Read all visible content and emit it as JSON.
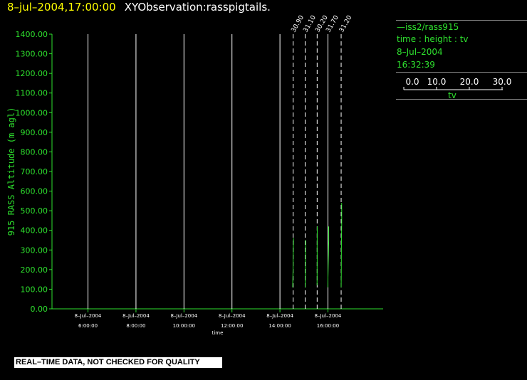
{
  "title": {
    "datetime": "8–jul–2004,17:00:00",
    "observation": "XYObservation:rasspigtails."
  },
  "legend": {
    "station": "—iss2/rass915",
    "variables": "time : height : tv",
    "date": "8–Jul–2004",
    "time": "16:32:39",
    "scale_ticks": [
      "0.0",
      "10.0",
      "20.0",
      "30.0"
    ],
    "scale_label": "tv"
  },
  "warning": "REAL–TIME DATA, NOT CHECKED FOR QUALITY",
  "colors": {
    "axis": "#2ee02e",
    "trace": "#2ee02e",
    "gridline": "#ffffff",
    "title_time": "#ffff00",
    "background": "#000000"
  },
  "chart_data": {
    "type": "line",
    "xlabel": "time",
    "ylabel": "915 RASS Altitude (m agl)",
    "ylim": [
      0,
      1400
    ],
    "y_ticks": [
      "0.00",
      "100.00",
      "200.00",
      "300.00",
      "400.00",
      "500.00",
      "600.00",
      "700.00",
      "800.00",
      "900.00",
      "1000.00",
      "1100.00",
      "1200.00",
      "1300.00",
      "1400.00"
    ],
    "xlim_hours": [
      4.5,
      18.3
    ],
    "x_ticks": [
      {
        "hour": 6,
        "date": "8–Jul–2004",
        "time": "6:00:00"
      },
      {
        "hour": 8,
        "date": "8–Jul–2004",
        "time": "8:00:00"
      },
      {
        "hour": 10,
        "date": "8–Jul–2004",
        "time": "10:00:00"
      },
      {
        "hour": 12,
        "date": "8–Jul–2004",
        "time": "12:00:00"
      },
      {
        "hour": 14,
        "date": "8–Jul–2004",
        "time": "14:00:00"
      },
      {
        "hour": 16,
        "date": "8–Jul–2004",
        "time": "16:00:00"
      }
    ],
    "profile_scale_hours_per_degree": 0.02,
    "profiles": [
      {
        "base_hour": 14.55,
        "label": "30.90",
        "heights": [
          110,
          150,
          200,
          250,
          300,
          340,
          360
        ],
        "tv": [
          29.0,
          29.3,
          29.8,
          29.9,
          30.3,
          30.6,
          30.9
        ]
      },
      {
        "base_hour": 15.05,
        "label": "31.10",
        "heights": [
          110,
          150,
          200,
          260,
          300,
          330,
          350
        ],
        "tv": [
          30.2,
          30.4,
          30.6,
          30.7,
          30.8,
          31.0,
          31.1
        ]
      },
      {
        "base_hour": 15.55,
        "label": "30.20",
        "heights": [
          120,
          160,
          210,
          260,
          310,
          360,
          420
        ],
        "tv": [
          29.8,
          29.9,
          30.0,
          30.1,
          30.0,
          30.1,
          30.2
        ]
      },
      {
        "base_hour": 16.0,
        "label": "31.70",
        "heights": [
          110,
          160,
          220,
          280,
          320,
          350,
          380,
          420
        ],
        "tv": [
          29.8,
          30.0,
          30.5,
          31.0,
          31.4,
          31.7,
          31.6,
          31.5
        ]
      },
      {
        "base_hour": 16.55,
        "label": "31.20",
        "heights": [
          110,
          170,
          240,
          310,
          380,
          440,
          500,
          540
        ],
        "tv": [
          30.0,
          30.2,
          30.4,
          30.6,
          30.9,
          31.2,
          31.1,
          31.0
        ]
      }
    ]
  }
}
